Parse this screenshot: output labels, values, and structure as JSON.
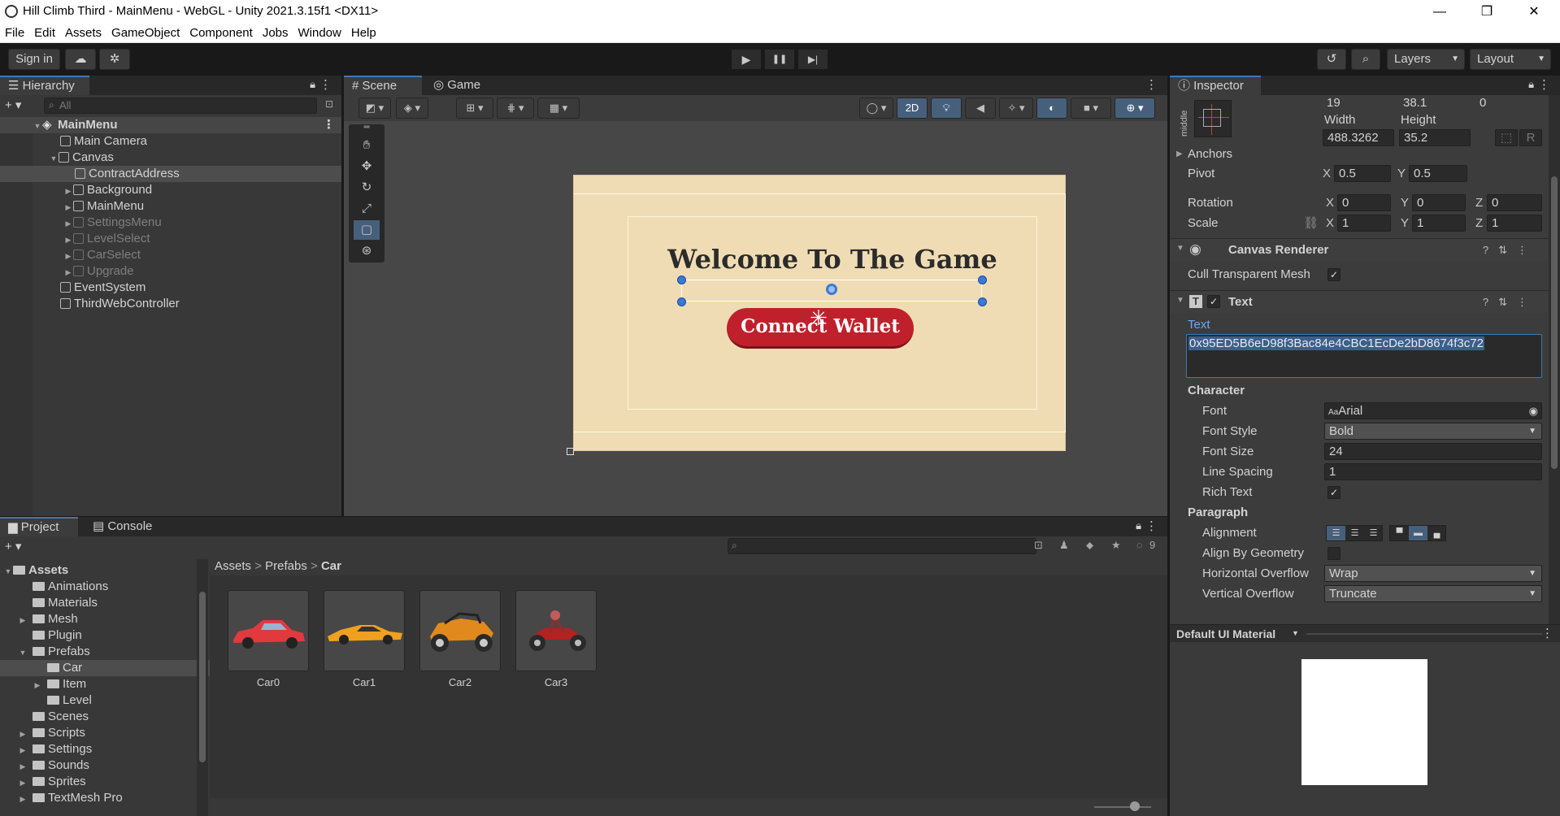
{
  "window": {
    "title": "Hill Climb Third - MainMenu - WebGL - Unity 2021.3.15f1 <DX11>",
    "minimize": "—",
    "maximize": "❐",
    "close": "✕"
  },
  "menu": [
    "File",
    "Edit",
    "Assets",
    "GameObject",
    "Component",
    "Jobs",
    "Window",
    "Help"
  ],
  "toolbar": {
    "sign_in": "Sign in",
    "play": "▶",
    "pause": "❚❚",
    "step": "▶|",
    "layers": "Layers",
    "layout": "Layout"
  },
  "hierarchy": {
    "tab": "Hierarchy",
    "search_placeholder": "All",
    "scene": "MainMenu",
    "items": [
      {
        "label": "Main Camera"
      },
      {
        "label": "Canvas"
      },
      {
        "label": "ContractAddress"
      },
      {
        "label": "Background"
      },
      {
        "label": "MainMenu"
      },
      {
        "label": "SettingsMenu"
      },
      {
        "label": "LevelSelect"
      },
      {
        "label": "CarSelect"
      },
      {
        "label": "Upgrade"
      },
      {
        "label": "EventSystem"
      },
      {
        "label": "ThirdWebController"
      }
    ]
  },
  "scene": {
    "tabs": [
      "Scene",
      "Game"
    ],
    "mode_2d": "2D",
    "canvas_title": "Welcome To The Game",
    "button_label": "Connect Wallet",
    "colors": {
      "canvas_bg": "#f0dcb4",
      "button": "#c0202c",
      "title": "#2b2b2b"
    }
  },
  "project": {
    "tabs": [
      "Project",
      "Console"
    ],
    "hidden_count": "9",
    "tree": {
      "root": "Assets",
      "items": [
        "Animations",
        "Materials",
        "Mesh",
        "Plugin",
        "Prefabs",
        "Car",
        "Item",
        "Level",
        "Scenes",
        "Scripts",
        "Settings",
        "Sounds",
        "Sprites",
        "TextMesh Pro"
      ]
    },
    "breadcrumb": [
      "Assets",
      "Prefabs",
      "Car"
    ],
    "assets": [
      {
        "name": "Car0"
      },
      {
        "name": "Car1"
      },
      {
        "name": "Car2"
      },
      {
        "name": "Car3"
      }
    ]
  },
  "inspector": {
    "tab": "Inspector",
    "anchor_preset": "middle",
    "pos_x": "19",
    "pos_y": "38.1",
    "pos_z": "0",
    "width_label": "Width",
    "height_label": "Height",
    "width": "488.3262",
    "height": "35.2",
    "anchors": "Anchors",
    "pivot": {
      "label": "Pivot",
      "x": "0.5",
      "y": "0.5"
    },
    "rotation": {
      "label": "Rotation",
      "x": "0",
      "y": "0",
      "z": "0"
    },
    "scale": {
      "label": "Scale",
      "x": "1",
      "y": "1",
      "z": "1"
    },
    "canvas_renderer": {
      "title": "Canvas Renderer",
      "cull_label": "Cull Transparent Mesh"
    },
    "text_component": {
      "title": "Text",
      "text_label": "Text",
      "text_value": "0x95ED5B6eD98f3Bac84e4CBC1EcDe2bD8674f3c72",
      "character": "Character",
      "font_label": "Font",
      "font": "Arial",
      "font_style_label": "Font Style",
      "font_style": "Bold",
      "font_size_label": "Font Size",
      "font_size": "24",
      "line_spacing_label": "Line Spacing",
      "line_spacing": "1",
      "rich_text_label": "Rich Text",
      "paragraph": "Paragraph",
      "alignment_label": "Alignment",
      "align_geometry_label": "Align By Geometry",
      "h_overflow_label": "Horizontal Overflow",
      "h_overflow": "Wrap",
      "v_overflow_label": "Vertical Overflow",
      "v_overflow": "Truncate"
    },
    "material": "Default UI Material"
  }
}
